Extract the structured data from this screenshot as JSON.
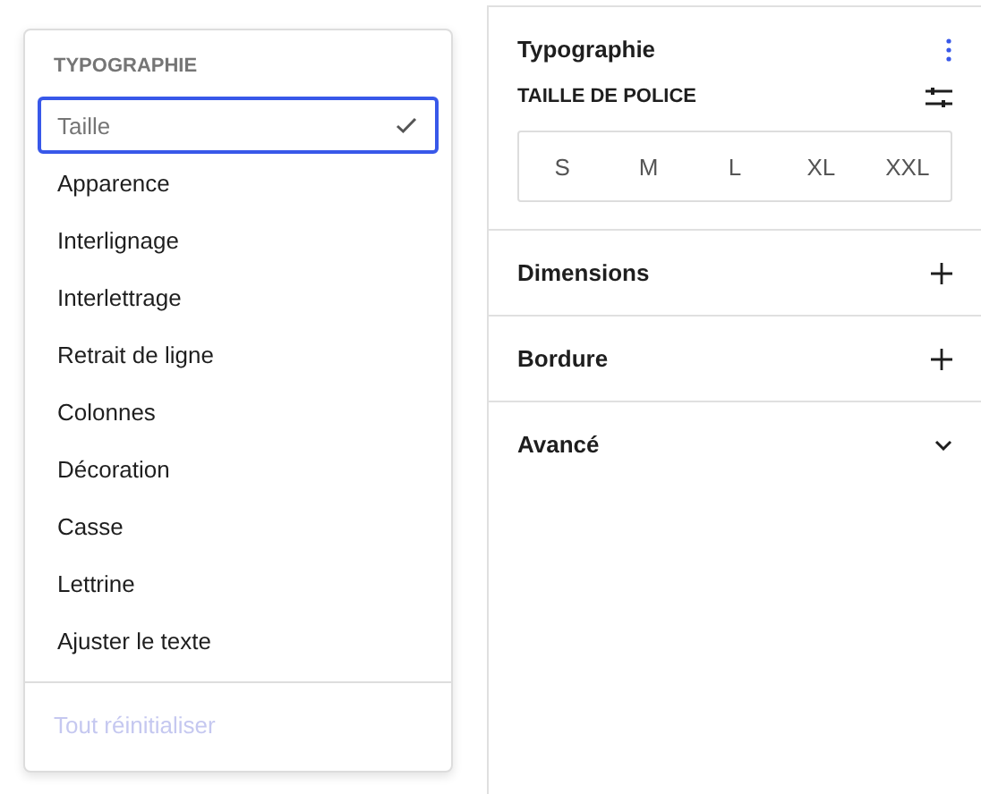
{
  "menu": {
    "heading": "TYPOGRAPHIE",
    "items": [
      {
        "label": "Taille",
        "selected": true
      },
      {
        "label": "Apparence",
        "selected": false
      },
      {
        "label": "Interlignage",
        "selected": false
      },
      {
        "label": "Interlettrage",
        "selected": false
      },
      {
        "label": "Retrait de ligne",
        "selected": false
      },
      {
        "label": "Colonnes",
        "selected": false
      },
      {
        "label": "Décoration",
        "selected": false
      },
      {
        "label": "Casse",
        "selected": false
      },
      {
        "label": "Lettrine",
        "selected": false
      },
      {
        "label": "Ajuster le texte",
        "selected": false
      }
    ],
    "reset": {
      "label": "Tout réinitialiser",
      "disabled": true
    }
  },
  "panel": {
    "title": "Typographie",
    "font_size_label": "TAILLE DE POLICE",
    "sizes": [
      {
        "label": "S",
        "selected": false
      },
      {
        "label": "M",
        "selected": false
      },
      {
        "label": "L",
        "selected": false
      },
      {
        "label": "XL",
        "selected": false
      },
      {
        "label": "XXL",
        "selected": false
      }
    ],
    "sections": [
      {
        "title": "Dimensions",
        "kind": "add"
      },
      {
        "title": "Bordure",
        "kind": "add"
      },
      {
        "title": "Avancé",
        "kind": "expand"
      }
    ]
  }
}
